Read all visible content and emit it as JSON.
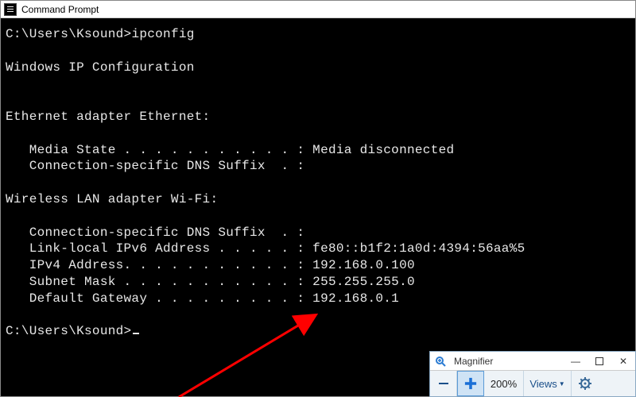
{
  "cmd": {
    "title": "Command Prompt",
    "prompt1": "C:\\Users\\Ksound>",
    "command": "ipconfig",
    "heading": "Windows IP Configuration",
    "eth_header": "Ethernet adapter Ethernet:",
    "eth_media_label": "   Media State . . . . . . . . . . . :",
    "eth_media_value": " Media disconnected",
    "eth_dns_label": "   Connection-specific DNS Suffix  . :",
    "wifi_header": "Wireless LAN adapter Wi-Fi:",
    "wifi_dns_label": "   Connection-specific DNS Suffix  . :",
    "wifi_ipv6_label": "   Link-local IPv6 Address . . . . . :",
    "wifi_ipv6_value": " fe80::b1f2:1a0d:4394:56aa%5",
    "wifi_ipv4_label": "   IPv4 Address. . . . . . . . . . . :",
    "wifi_ipv4_value": " 192.168.0.100",
    "wifi_mask_label": "   Subnet Mask . . . . . . . . . . . :",
    "wifi_mask_value": " 255.255.255.0",
    "wifi_gw_label": "   Default Gateway . . . . . . . . . :",
    "wifi_gw_value": " 192.168.0.1",
    "prompt2": "C:\\Users\\Ksound>"
  },
  "magnifier": {
    "title": "Magnifier",
    "minus": "−",
    "plus": "+",
    "zoom": "200%",
    "views": "Views",
    "min_btn": "—",
    "max_btn": "▢",
    "close_btn": "✕"
  },
  "annotation": {
    "arrow_color": "#ff0000"
  }
}
